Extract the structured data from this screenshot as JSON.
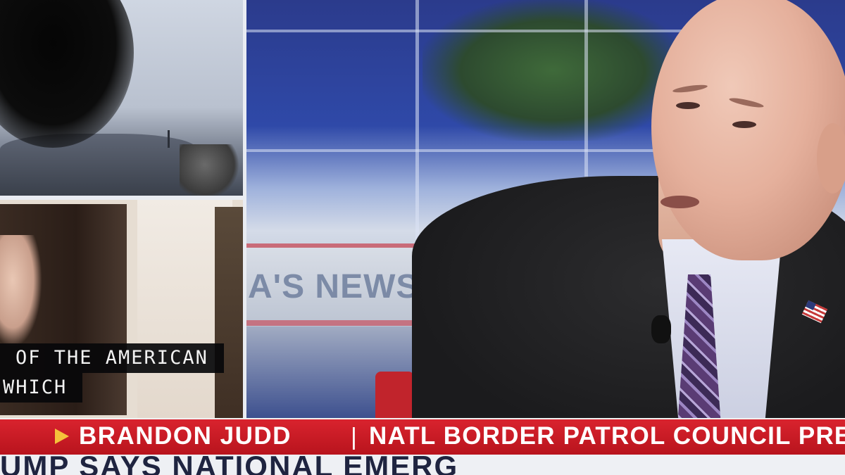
{
  "caption": {
    "line1": "OF THE AMERICAN",
    "line2": "WHICH"
  },
  "studio": {
    "sign_text": "A'S NEWSR"
  },
  "lower_third": {
    "name": "BRANDON JUDD",
    "separator": "|",
    "title": "NATL BORDER PATROL COUNCIL PRES",
    "accent_color": "#d9232e",
    "icon": "play-icon"
  },
  "ticker": {
    "text": "UMP SAYS NATIONAL EMERG"
  }
}
